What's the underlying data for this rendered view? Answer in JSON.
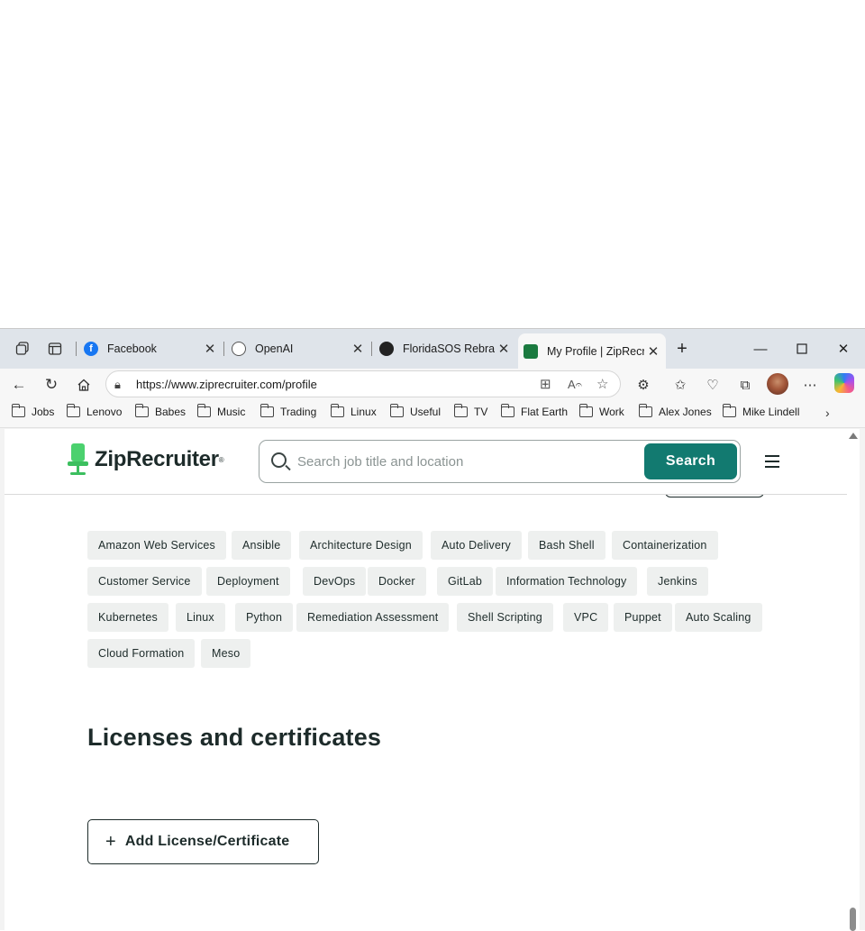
{
  "browser": {
    "tabs": [
      {
        "title": "Facebook",
        "favicon": "facebook-icon",
        "color": "#1877f2"
      },
      {
        "title": "OpenAI",
        "favicon": "openai-icon",
        "color": "#555555"
      },
      {
        "title": "FloridaSOS Rebrand",
        "favicon": "openai-icon",
        "color": "#222222"
      },
      {
        "title": "My Profile | ZipRecruiter",
        "favicon": "ziprecruiter-icon",
        "color": "#1a7a3f",
        "active": true
      }
    ],
    "url": "https://www.ziprecruiter.com/profile",
    "bookmarks": [
      "Jobs",
      "Lenovo",
      "Babes",
      "Music",
      "Trading",
      "Linux",
      "Useful",
      "TV",
      "Flat Earth",
      "Work",
      "Alex Jones",
      "Mike Lindell"
    ]
  },
  "header": {
    "logo_text": "ZipRecruiter",
    "logo_mark": "®",
    "search_placeholder": "Search job title and location",
    "search_button": "Search"
  },
  "skills": [
    "Amazon Web Services",
    "Ansible",
    "Architecture Design",
    "Auto Delivery",
    "Bash Shell",
    "Containerization",
    "Customer Service",
    "Deployment",
    "DevOps",
    "Docker",
    "GitLab",
    "Information Technology",
    "Jenkins",
    "Kubernetes",
    "Linux",
    "Python",
    "Remediation Assessment",
    "Shell Scripting",
    "VPC",
    "Puppet",
    "Auto Scaling",
    "Cloud Formation",
    "Meso"
  ],
  "licenses": {
    "title": "Licenses and certificates",
    "add_button": "Add License/Certificate"
  },
  "colors": {
    "brand_green": "#4bd16e",
    "search_button": "#127a70",
    "text_dark": "#1d2b2a",
    "chip_bg": "#eef0ef"
  }
}
